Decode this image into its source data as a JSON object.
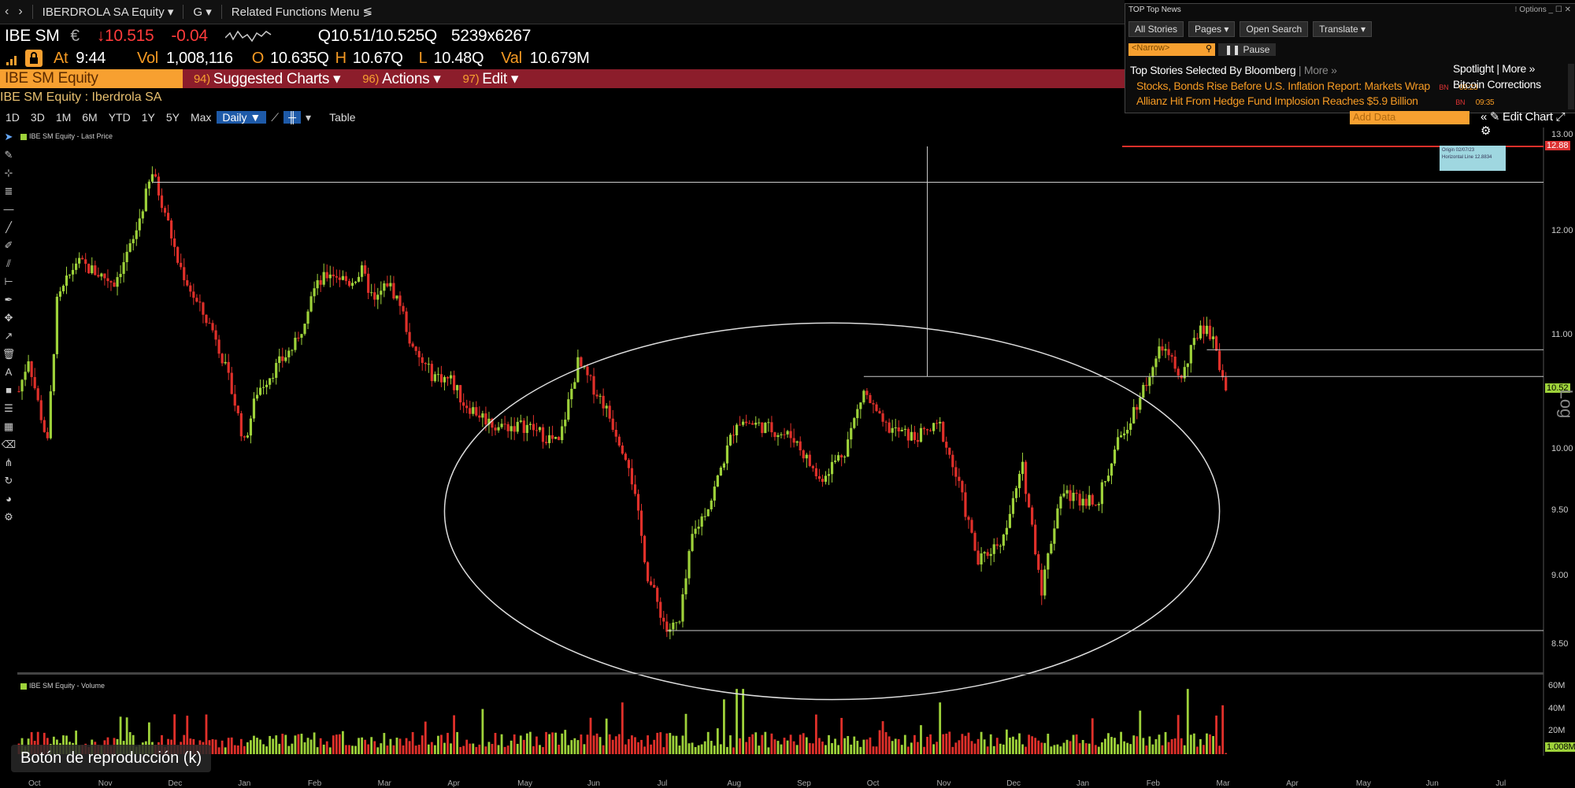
{
  "topbar": {
    "back": "‹",
    "forward": "›",
    "security": "IBERDROLA SA Equity ▾",
    "g": "G ▾",
    "related": "Related Functions Menu ≶"
  },
  "quote": {
    "ticker": "IBE SM",
    "currency": "€",
    "last": "↓10.515",
    "change": "-0.04",
    "bidask": "Q10.51/10.525Q",
    "size": "5239x6267",
    "at_label": "At",
    "time": "9:44",
    "vol_label": "Vol",
    "vol": "1,008,116",
    "o_label": "O",
    "open": "10.635Q",
    "h_label": "H",
    "high": "10.67Q",
    "l_label": "L",
    "low": "10.48Q",
    "val_label": "Val",
    "val": "10.679M"
  },
  "secbar": {
    "label": "IBE SM Equity",
    "menus": [
      {
        "num": "94)",
        "label": "Suggested Charts ▾"
      },
      {
        "num": "96)",
        "label": "Actions ▾"
      },
      {
        "num": "97)",
        "label": "Edit ▾"
      }
    ],
    "name": "IBE SM Equity : Iberdrola SA"
  },
  "chart_toolbar": {
    "periods": [
      "1D",
      "3D",
      "1M",
      "6M",
      "YTD",
      "1Y",
      "5Y",
      "Max"
    ],
    "frequency": "Daily ▼",
    "table": "Table"
  },
  "news": {
    "title": "TOP Top News",
    "options": "⁝ Options  _  ☐  ✕",
    "tabs": [
      "All Stories",
      "Pages ▾",
      "Open Search",
      "Translate ▾"
    ],
    "narrow": "<Narrow>",
    "pause": "❚❚ Pause",
    "heading": "Top Stories Selected By Bloomberg",
    "more": "| More »",
    "stories": [
      {
        "title": "Stocks, Bonds Rise Before U.S. Inflation Report: Markets Wrap",
        "src": "BN",
        "time": "09:23"
      },
      {
        "title": "Allianz Hit From Hedge Fund Implosion Reaches $5.9 Billion",
        "src": "BN",
        "time": "09:35"
      }
    ],
    "spotlight": "Spotlight | More »",
    "spotlight_item": "Bitcoin Corrections"
  },
  "chart_controls": {
    "add_data": "Add Data",
    "edit_chart": "« ✎ Edit Chart ⤢ ⚙"
  },
  "tooltip": {
    "line1": "Origin 02/07/23",
    "line2": "Horizontal Line 12.8834"
  },
  "colors": {
    "up": "#9ed23a",
    "down": "#e0302a",
    "accent": "#f7a030",
    "secbar": "#8c1d2b"
  },
  "chart_data": {
    "type": "candlestick",
    "price_legend": "IBE SM Equity - Last Price",
    "volume_legend": "IBE SM Equity - Volume",
    "scale": "Log",
    "x_ticks": [
      "Oct",
      "Nov",
      "Dec",
      "Jan",
      "Feb",
      "Mar",
      "Apr",
      "May",
      "Jun",
      "Jul",
      "Aug",
      "Sep",
      "Oct",
      "Nov",
      "Dec",
      "Jan",
      "Feb",
      "Mar",
      "Apr",
      "May",
      "Jun",
      "Jul"
    ],
    "y_ticks": [
      "13.00",
      "12.00",
      "11.00",
      "10.00",
      "9.50",
      "9.00",
      "8.50"
    ],
    "y_range": [
      8.3,
      13.05
    ],
    "last_price_label": "10.52",
    "horizontal_line_label": "12.88",
    "vol_ticks": [
      "60M",
      "40M",
      "20M"
    ],
    "last_volume_label": "1.008M",
    "anchors": [
      [
        0,
        10.5
      ],
      [
        3,
        10.8
      ],
      [
        6,
        10.4
      ],
      [
        9,
        10.05
      ],
      [
        12,
        11.3
      ],
      [
        18,
        11.7
      ],
      [
        24,
        11.6
      ],
      [
        30,
        11.5
      ],
      [
        36,
        11.9
      ],
      [
        42,
        12.6
      ],
      [
        46,
        12.2
      ],
      [
        50,
        11.7
      ],
      [
        56,
        11.3
      ],
      [
        62,
        11.0
      ],
      [
        68,
        10.4
      ],
      [
        71,
        10.05
      ],
      [
        75,
        10.5
      ],
      [
        82,
        10.75
      ],
      [
        88,
        10.95
      ],
      [
        92,
        11.4
      ],
      [
        98,
        11.6
      ],
      [
        104,
        11.5
      ],
      [
        108,
        11.6
      ],
      [
        112,
        11.3
      ],
      [
        116,
        11.5
      ],
      [
        120,
        11.3
      ],
      [
        124,
        10.85
      ],
      [
        130,
        10.65
      ],
      [
        136,
        10.6
      ],
      [
        140,
        10.4
      ],
      [
        150,
        10.2
      ],
      [
        160,
        10.2
      ],
      [
        170,
        10.05
      ],
      [
        176,
        10.75
      ],
      [
        184,
        10.4
      ],
      [
        192,
        9.9
      ],
      [
        198,
        9.0
      ],
      [
        204,
        8.6
      ],
      [
        208,
        8.65
      ],
      [
        212,
        9.3
      ],
      [
        218,
        9.6
      ],
      [
        226,
        10.25
      ],
      [
        234,
        10.2
      ],
      [
        244,
        10.1
      ],
      [
        252,
        9.75
      ],
      [
        260,
        10.0
      ],
      [
        266,
        10.5
      ],
      [
        272,
        10.2
      ],
      [
        282,
        10.1
      ],
      [
        290,
        10.2
      ],
      [
        296,
        9.7
      ],
      [
        302,
        9.1
      ],
      [
        310,
        9.3
      ],
      [
        316,
        9.85
      ],
      [
        322,
        8.9
      ],
      [
        328,
        9.65
      ],
      [
        334,
        9.6
      ],
      [
        340,
        9.6
      ],
      [
        346,
        10.05
      ],
      [
        352,
        10.4
      ],
      [
        360,
        10.9
      ],
      [
        366,
        10.6
      ],
      [
        372,
        11.1
      ],
      [
        376,
        11.0
      ],
      [
        380,
        10.5
      ]
    ],
    "horizontal_lines": [
      12.88,
      12.5,
      10.87,
      10.63,
      8.6
    ],
    "ellipse": {
      "center_day": 256,
      "center_price": 9.5,
      "top_price": 11.2,
      "bottom_price": 8.18,
      "half_width_days": 122
    }
  },
  "play_button": "Botón de reproducción (k)"
}
